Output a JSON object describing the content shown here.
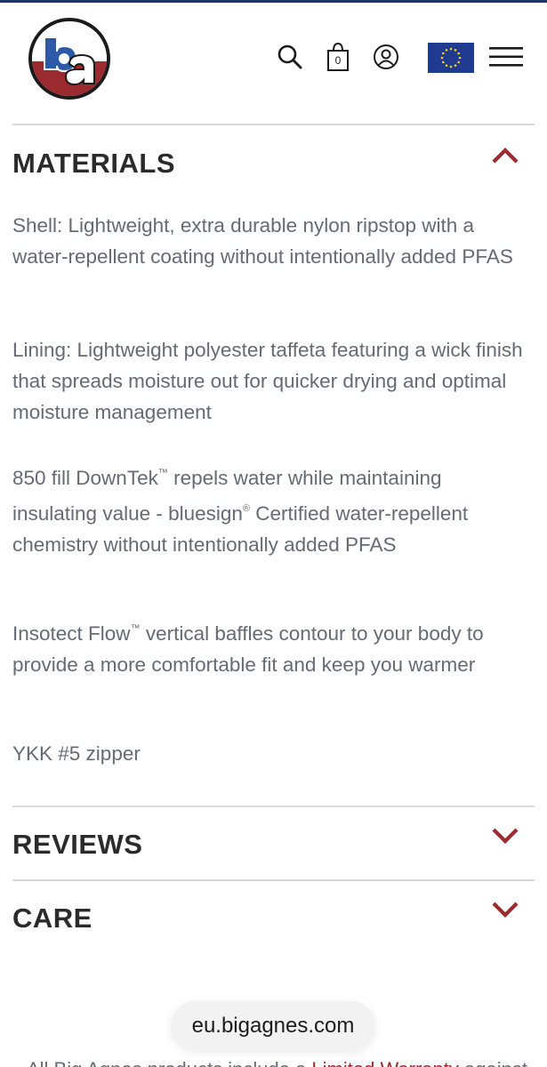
{
  "header": {
    "logo_alt": "ba",
    "cart_count": "0",
    "icons": {
      "search": "search-icon",
      "cart": "shopping-bag-icon",
      "account": "user-icon",
      "region": "eu-flag-icon",
      "menu": "hamburger-menu-icon"
    }
  },
  "sections": {
    "materials": {
      "title": "MATERIALS",
      "state": "expanded",
      "paragraphs": {
        "p1": "Shell: Lightweight, extra durable nylon ripstop with a water-repellent coating without intentionally added PFAS",
        "p2": "Lining: Lightweight polyester taffeta featuring a wick finish that spreads moisture out for quicker drying and optimal moisture management",
        "p3_a": "850 fill DownTek",
        "p3_tm": "™",
        "p3_b": " repels water while maintaining insulating value - bluesign",
        "p3_reg": "®",
        "p3_c": " Certified water-repellent chemistry without intentionally added PFAS",
        "p4_a": "Insotect Flow",
        "p4_tm": "™",
        "p4_b": " vertical baffles contour to your body to provide a more comfortable fit and keep you warmer",
        "p5": "YKK #5 zipper"
      }
    },
    "reviews": {
      "title": "REVIEWS",
      "state": "collapsed"
    },
    "care": {
      "title": "CARE",
      "state": "collapsed"
    }
  },
  "browser": {
    "url": "eu.bigagnes.com"
  },
  "footer": {
    "partial_text": "All Big Agnes products include a ",
    "partial_link": "Limited Warranty",
    "partial_tail": " against"
  },
  "colors": {
    "accent": "#9b2b2f",
    "text": "#2b2b2b",
    "body_text": "#666a73",
    "divider": "#d9d9d9",
    "flag_blue": "#1f3a8f",
    "flag_star": "#f2d31c"
  }
}
